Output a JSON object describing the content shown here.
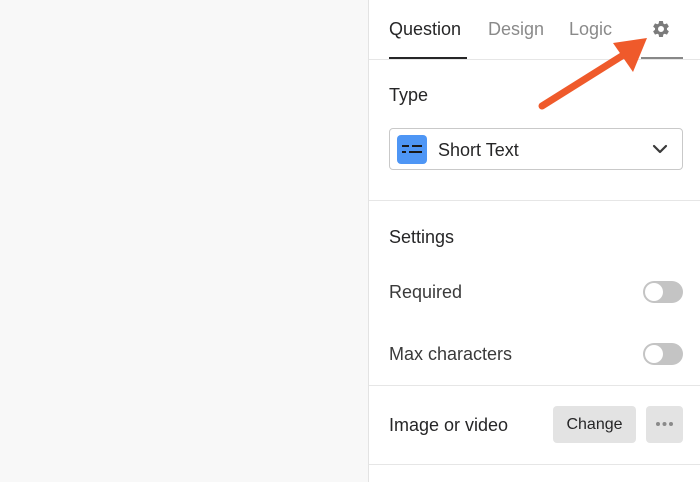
{
  "tabs": [
    {
      "label": "Question",
      "active": true
    },
    {
      "label": "Design",
      "active": false
    },
    {
      "label": "Logic",
      "active": false
    }
  ],
  "settings_tab_icon": "gear-icon",
  "type_section": {
    "title": "Type",
    "selected_value": "Short Text",
    "type_icon": "short-text-icon",
    "type_icon_color": "#4e96f5"
  },
  "settings_section": {
    "title": "Settings",
    "rows": [
      {
        "label": "Required",
        "enabled": false
      },
      {
        "label": "Max characters",
        "enabled": false
      }
    ]
  },
  "media_section": {
    "label": "Image or video",
    "change_button": "Change",
    "more_icon": "more-dots-icon"
  },
  "colors": {
    "annotation_arrow": "#ef5a2b",
    "toggle_off": "#c4c4c4"
  }
}
